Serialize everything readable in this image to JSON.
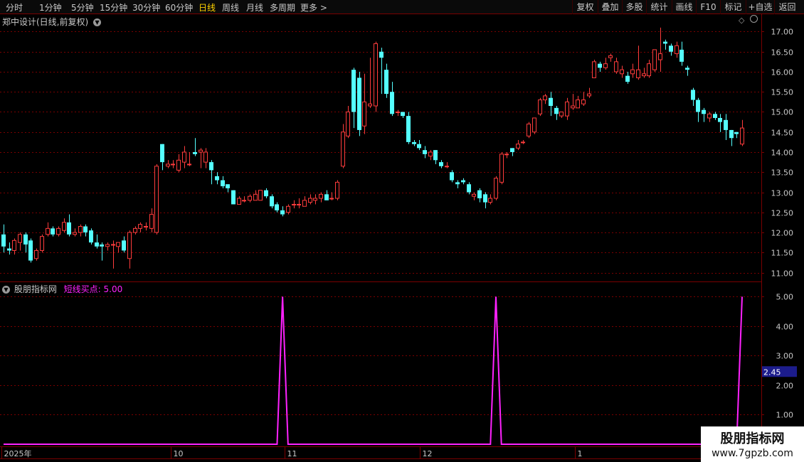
{
  "toolbar": {
    "periods": [
      "分时",
      "1分钟",
      "5分钟",
      "15分钟",
      "30分钟",
      "60分钟",
      "日线",
      "周线",
      "月线",
      "多周期",
      "更多 >"
    ],
    "active_period": "日线",
    "right_buttons": [
      "复权",
      "叠加",
      "多股",
      "统计",
      "画线",
      "F10",
      "标记",
      "+自选",
      "返回"
    ]
  },
  "main_title": "郑中设计(日线,前复权)",
  "indicator": {
    "name": "股朋指标网",
    "value_label": "短线买点: 5.00"
  },
  "watermark": {
    "line1": "股朋指标网",
    "line2": "www.7gpzb.com"
  },
  "colors": {
    "up": "#ff3c3c",
    "down": "#54ffff",
    "signal": "#ff22ff",
    "grid": "#7a0000",
    "axis_text": "#c8c8c8"
  },
  "chart_data": [
    {
      "type": "candlestick",
      "title": "郑中设计(日线,前复权)",
      "ylim": [
        10.85,
        17.15
      ],
      "y_ticks": [
        11.0,
        11.5,
        12.0,
        12.5,
        13.0,
        13.5,
        14.0,
        14.5,
        15.0,
        15.5,
        16.0,
        16.5,
        17.0
      ],
      "x_tick_labels": [
        "2025年",
        "10",
        "11",
        "12",
        "1"
      ],
      "candles": [
        [
          11.95,
          11.65,
          12.2,
          11.5
        ],
        [
          11.6,
          11.55,
          11.75,
          11.45
        ],
        [
          11.55,
          11.8,
          11.85,
          11.45
        ],
        [
          11.75,
          11.95,
          12.0,
          11.55
        ],
        [
          11.95,
          11.7,
          12.0,
          11.5
        ],
        [
          11.8,
          11.3,
          11.85,
          11.25
        ],
        [
          11.35,
          11.55,
          11.6,
          11.3
        ],
        [
          11.55,
          11.9,
          11.95,
          11.5
        ],
        [
          11.95,
          12.1,
          12.25,
          11.9
        ],
        [
          12.1,
          11.95,
          12.15,
          11.9
        ],
        [
          11.95,
          12.1,
          12.15,
          11.9
        ],
        [
          12.05,
          12.25,
          12.35,
          12.0
        ],
        [
          12.25,
          11.95,
          12.45,
          11.9
        ],
        [
          11.95,
          12.0,
          12.1,
          11.9
        ],
        [
          12.0,
          12.15,
          12.2,
          11.9
        ],
        [
          12.15,
          12.0,
          12.2,
          11.9
        ],
        [
          12.05,
          11.75,
          12.1,
          11.7
        ],
        [
          11.75,
          11.65,
          11.95,
          11.6
        ],
        [
          11.7,
          11.65,
          11.75,
          11.3
        ],
        [
          11.65,
          11.7,
          11.75,
          11.55
        ],
        [
          11.7,
          11.7,
          11.8,
          11.1
        ],
        [
          11.65,
          11.75,
          11.75,
          11.5
        ],
        [
          11.8,
          11.55,
          11.9,
          11.5
        ],
        [
          11.35,
          12.0,
          12.05,
          11.1
        ],
        [
          12.0,
          12.1,
          12.15,
          11.95
        ],
        [
          12.1,
          12.2,
          12.25,
          12.0
        ],
        [
          12.15,
          12.15,
          12.25,
          12.05
        ],
        [
          12.1,
          12.45,
          12.6,
          12.0
        ],
        [
          12.0,
          13.65,
          13.7,
          11.95
        ],
        [
          14.2,
          13.75,
          14.2,
          13.55
        ],
        [
          13.65,
          13.7,
          13.8,
          13.6
        ],
        [
          13.7,
          13.7,
          13.8,
          13.6
        ],
        [
          13.55,
          13.8,
          13.95,
          13.5
        ],
        [
          13.75,
          14.0,
          14.15,
          13.6
        ],
        [
          13.7,
          13.7,
          14.0,
          13.65
        ],
        [
          14.0,
          13.95,
          14.35,
          13.9
        ],
        [
          14.0,
          14.05,
          14.1,
          13.6
        ],
        [
          13.75,
          14.0,
          14.1,
          13.6
        ],
        [
          13.75,
          13.55,
          13.8,
          13.2
        ],
        [
          13.4,
          13.3,
          13.5,
          13.2
        ],
        [
          13.3,
          13.15,
          13.4,
          13.1
        ],
        [
          13.2,
          13.1,
          13.2,
          13.0
        ],
        [
          13.05,
          12.7,
          13.05,
          12.7
        ],
        [
          12.7,
          12.85,
          12.9,
          12.7
        ],
        [
          12.8,
          12.8,
          12.9,
          12.75
        ],
        [
          12.8,
          12.9,
          12.95,
          12.75
        ],
        [
          12.8,
          12.95,
          13.05,
          12.8
        ],
        [
          12.8,
          13.05,
          13.05,
          12.8
        ],
        [
          13.05,
          12.9,
          13.1,
          12.85
        ],
        [
          12.9,
          12.65,
          12.95,
          12.6
        ],
        [
          12.7,
          12.55,
          12.75,
          12.5
        ],
        [
          12.55,
          12.45,
          12.65,
          12.4
        ],
        [
          12.5,
          12.65,
          12.7,
          12.45
        ],
        [
          12.7,
          12.7,
          12.8,
          12.6
        ],
        [
          12.7,
          12.7,
          12.85,
          12.6
        ],
        [
          12.65,
          12.8,
          12.9,
          12.65
        ],
        [
          12.75,
          12.85,
          12.95,
          12.7
        ],
        [
          12.8,
          12.85,
          12.95,
          12.7
        ],
        [
          12.85,
          12.95,
          13.0,
          12.75
        ],
        [
          12.95,
          12.8,
          13.05,
          12.8
        ],
        [
          12.85,
          12.85,
          13.0,
          12.8
        ],
        [
          12.85,
          13.25,
          13.3,
          12.8
        ],
        [
          13.65,
          14.5,
          14.7,
          13.6
        ],
        [
          14.4,
          15.0,
          15.15,
          14.35
        ],
        [
          16.05,
          15.0,
          16.1,
          14.6
        ],
        [
          15.85,
          14.55,
          16.0,
          14.4
        ],
        [
          14.65,
          15.25,
          15.95,
          14.45
        ],
        [
          15.15,
          15.2,
          16.35,
          15.1
        ],
        [
          15.15,
          16.7,
          16.75,
          15.0
        ],
        [
          16.5,
          16.35,
          16.6,
          15.45
        ],
        [
          16.05,
          15.45,
          16.2,
          15.35
        ],
        [
          15.5,
          14.95,
          15.75,
          14.9
        ],
        [
          15.0,
          15.0,
          15.05,
          14.9
        ],
        [
          15.0,
          14.9,
          15.0,
          14.85
        ],
        [
          14.9,
          14.25,
          15.0,
          14.2
        ],
        [
          14.25,
          14.2,
          14.3,
          14.15
        ],
        [
          14.2,
          14.1,
          14.3,
          14.05
        ],
        [
          14.05,
          13.95,
          14.15,
          13.85
        ],
        [
          13.9,
          14.0,
          14.05,
          13.8
        ],
        [
          14.05,
          13.8,
          14.05,
          13.7
        ],
        [
          13.75,
          13.65,
          13.8,
          13.6
        ],
        [
          13.65,
          13.65,
          13.75,
          13.6
        ],
        [
          13.5,
          13.3,
          13.55,
          13.25
        ],
        [
          13.25,
          13.2,
          13.3,
          13.1
        ],
        [
          13.3,
          13.25,
          13.35,
          13.2
        ],
        [
          13.2,
          13.0,
          13.25,
          12.95
        ],
        [
          12.9,
          12.95,
          13.0,
          12.8
        ],
        [
          13.05,
          12.85,
          13.1,
          12.75
        ],
        [
          12.95,
          12.75,
          13.0,
          12.6
        ],
        [
          12.75,
          12.85,
          12.95,
          12.7
        ],
        [
          12.85,
          13.35,
          13.4,
          12.8
        ],
        [
          13.25,
          13.95,
          14.0,
          13.2
        ],
        [
          13.95,
          13.95,
          14.0,
          13.85
        ],
        [
          14.1,
          14.0,
          14.1,
          13.9
        ],
        [
          14.1,
          14.2,
          14.3,
          14.05
        ],
        [
          14.25,
          14.25,
          14.3,
          14.2
        ],
        [
          14.4,
          14.7,
          14.75,
          14.35
        ],
        [
          14.5,
          14.85,
          14.85,
          14.45
        ],
        [
          14.95,
          15.3,
          15.35,
          14.9
        ],
        [
          15.3,
          15.4,
          15.45,
          15.2
        ],
        [
          15.35,
          15.15,
          15.5,
          14.9
        ],
        [
          15.1,
          14.95,
          15.15,
          14.8
        ],
        [
          14.9,
          15.0,
          15.0,
          14.85
        ],
        [
          14.9,
          15.25,
          15.35,
          14.8
        ],
        [
          15.1,
          15.15,
          15.45,
          15.05
        ],
        [
          15.1,
          15.3,
          15.4,
          15.1
        ],
        [
          15.2,
          15.3,
          15.5,
          15.15
        ],
        [
          15.4,
          15.45,
          15.6,
          15.35
        ],
        [
          15.85,
          16.25,
          16.3,
          15.85
        ],
        [
          16.2,
          16.1,
          16.25,
          16.0
        ],
        [
          16.1,
          16.2,
          16.35,
          16.05
        ],
        [
          16.35,
          16.4,
          16.45,
          16.25
        ],
        [
          16.0,
          16.25,
          16.35,
          15.95
        ],
        [
          15.95,
          16.05,
          16.15,
          15.85
        ],
        [
          15.9,
          15.75,
          16.0,
          15.7
        ],
        [
          15.95,
          16.05,
          16.2,
          15.85
        ],
        [
          15.85,
          16.05,
          16.65,
          15.8
        ],
        [
          15.9,
          15.95,
          16.1,
          15.85
        ],
        [
          15.9,
          16.2,
          16.3,
          15.85
        ],
        [
          16.05,
          16.55,
          16.55,
          16.0
        ],
        [
          16.3,
          16.45,
          17.1,
          16.0
        ],
        [
          16.75,
          16.7,
          16.8,
          16.55
        ],
        [
          16.65,
          16.5,
          16.7,
          16.4
        ],
        [
          16.45,
          16.65,
          16.75,
          16.35
        ],
        [
          16.55,
          16.25,
          16.75,
          16.15
        ],
        [
          16.1,
          16.05,
          16.15,
          15.9
        ],
        [
          15.55,
          15.3,
          15.6,
          15.15
        ],
        [
          15.3,
          15.0,
          15.35,
          14.75
        ],
        [
          15.05,
          14.95,
          15.1,
          14.75
        ],
        [
          14.85,
          14.95,
          15.0,
          14.75
        ],
        [
          14.95,
          14.85,
          15.0,
          14.8
        ],
        [
          14.85,
          14.75,
          14.95,
          14.5
        ],
        [
          14.8,
          14.55,
          14.95,
          14.3
        ],
        [
          14.55,
          14.35,
          14.55,
          14.15
        ],
        [
          14.5,
          14.45,
          14.5,
          14.35
        ],
        [
          14.2,
          14.6,
          14.8,
          14.15
        ]
      ]
    },
    {
      "type": "line",
      "series_name": "短线买点",
      "ylim": [
        0,
        5.3
      ],
      "y_ticks": [
        1.0,
        2.0,
        3.0,
        4.0,
        5.0
      ],
      "crosshair_value": "2.45",
      "spikes": [
        {
          "index": 51,
          "value": 5
        },
        {
          "index": 90,
          "value": 5
        }
      ],
      "last_value": 5,
      "baseline": 0
    }
  ]
}
